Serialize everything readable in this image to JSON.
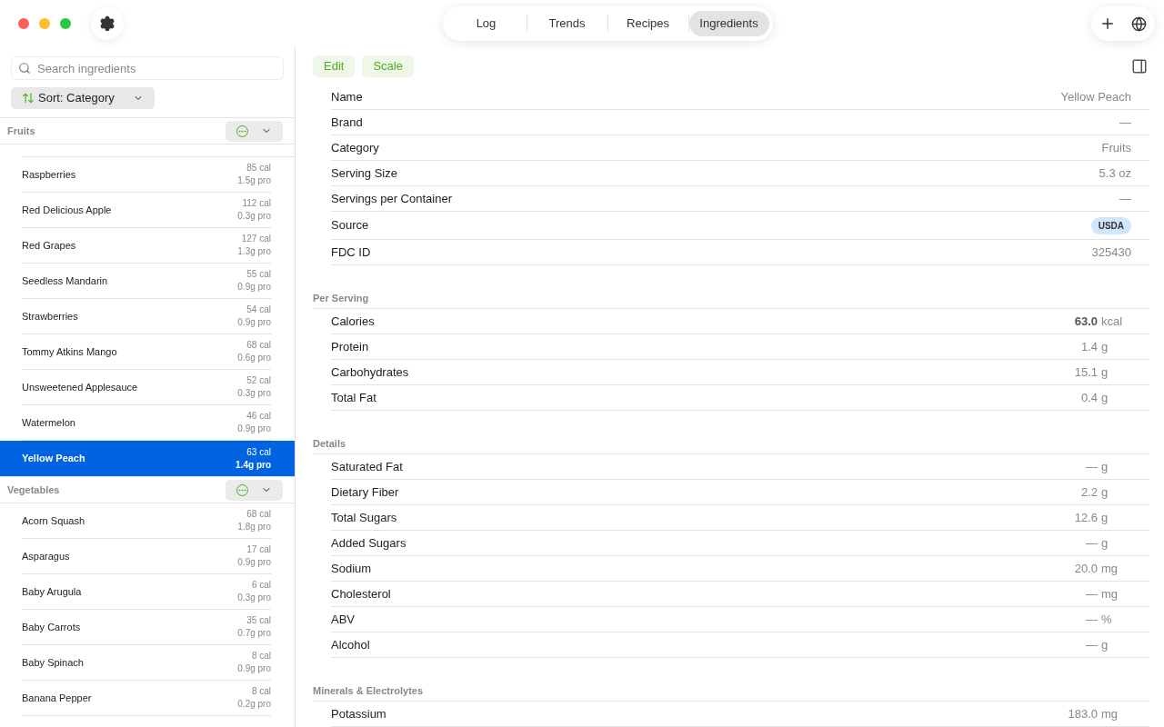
{
  "toolbar": {
    "tabs": [
      {
        "label": "Log",
        "selected": false
      },
      {
        "label": "Trends",
        "selected": false
      },
      {
        "label": "Recipes",
        "selected": false
      },
      {
        "label": "Ingredients",
        "selected": true
      }
    ]
  },
  "sidebar": {
    "search": {
      "placeholder": "Search ingredients"
    },
    "sort": {
      "label": "Sort: Category"
    },
    "groups": [
      {
        "name": "Fruits",
        "items": [
          {
            "name": "Raspberries",
            "calories": "85 cal",
            "protein": "1.5g pro",
            "selected": false
          },
          {
            "name": "Red Delicious Apple",
            "calories": "112 cal",
            "protein": "0.3g pro",
            "selected": false
          },
          {
            "name": "Red Grapes",
            "calories": "127 cal",
            "protein": "1.3g pro",
            "selected": false
          },
          {
            "name": "Seedless Mandarin",
            "calories": "55 cal",
            "protein": "0.9g pro",
            "selected": false
          },
          {
            "name": "Strawberries",
            "calories": "54 cal",
            "protein": "0.9g pro",
            "selected": false
          },
          {
            "name": "Tommy Atkins Mango",
            "calories": "68 cal",
            "protein": "0.6g pro",
            "selected": false
          },
          {
            "name": "Unsweetened Applesauce",
            "calories": "52 cal",
            "protein": "0.3g pro",
            "selected": false
          },
          {
            "name": "Watermelon",
            "calories": "46 cal",
            "protein": "0.9g pro",
            "selected": false
          },
          {
            "name": "Yellow Peach",
            "calories": "63 cal",
            "protein": "1.4g pro",
            "selected": true
          }
        ]
      },
      {
        "name": "Vegetables",
        "items": [
          {
            "name": "Acorn Squash",
            "calories": "68 cal",
            "protein": "1.8g pro",
            "selected": false
          },
          {
            "name": "Asparagus",
            "calories": "17 cal",
            "protein": "0.9g pro",
            "selected": false
          },
          {
            "name": "Baby Arugula",
            "calories": "6 cal",
            "protein": "0.3g pro",
            "selected": false
          },
          {
            "name": "Baby Carrots",
            "calories": "35 cal",
            "protein": "0.7g pro",
            "selected": false
          },
          {
            "name": "Baby Spinach",
            "calories": "8 cal",
            "protein": "0.9g pro",
            "selected": false
          },
          {
            "name": "Banana Pepper",
            "calories": "8 cal",
            "protein": "0.2g pro",
            "selected": false
          }
        ]
      }
    ]
  },
  "detail": {
    "actions": [
      "Edit",
      "Scale"
    ],
    "fields": [
      {
        "label": "Name",
        "value": "Yellow Peach",
        "kind": "text"
      },
      {
        "label": "Brand",
        "value": "—",
        "kind": "text"
      },
      {
        "label": "Category",
        "value": "Fruits",
        "kind": "text"
      },
      {
        "label": "Serving Size",
        "value": "5.3 oz",
        "kind": "text"
      },
      {
        "label": "Servings per Container",
        "value": "—",
        "kind": "text"
      },
      {
        "label": "Source",
        "value": "USDA",
        "kind": "badge"
      },
      {
        "label": "FDC ID",
        "value": "325430",
        "kind": "text"
      }
    ],
    "sections": [
      {
        "title": "Per Serving",
        "rows": [
          {
            "label": "Calories",
            "value": "63.0",
            "unit": "kcal",
            "bold": true
          },
          {
            "label": "Protein",
            "value": "1.4",
            "unit": "g",
            "bold": false
          },
          {
            "label": "Carbohydrates",
            "value": "15.1",
            "unit": "g",
            "bold": false
          },
          {
            "label": "Total Fat",
            "value": "0.4",
            "unit": "g",
            "bold": false
          }
        ]
      },
      {
        "title": "Details",
        "rows": [
          {
            "label": "Saturated Fat",
            "value": "—",
            "unit": "g",
            "bold": false
          },
          {
            "label": "Dietary Fiber",
            "value": "2.2",
            "unit": "g",
            "bold": false
          },
          {
            "label": "Total Sugars",
            "value": "12.6",
            "unit": "g",
            "bold": false
          },
          {
            "label": "Added Sugars",
            "value": "—",
            "unit": "g",
            "bold": false
          },
          {
            "label": "Sodium",
            "value": "20.0",
            "unit": "mg",
            "bold": false
          },
          {
            "label": "Cholesterol",
            "value": "—",
            "unit": "mg",
            "bold": false
          },
          {
            "label": "ABV",
            "value": "—",
            "unit": "%",
            "bold": false
          },
          {
            "label": "Alcohol",
            "value": "—",
            "unit": "g",
            "bold": false
          }
        ]
      },
      {
        "title": "Minerals & Electrolytes",
        "rows": [
          {
            "label": "Potassium",
            "value": "183.0",
            "unit": "mg",
            "bold": false
          }
        ]
      }
    ]
  }
}
